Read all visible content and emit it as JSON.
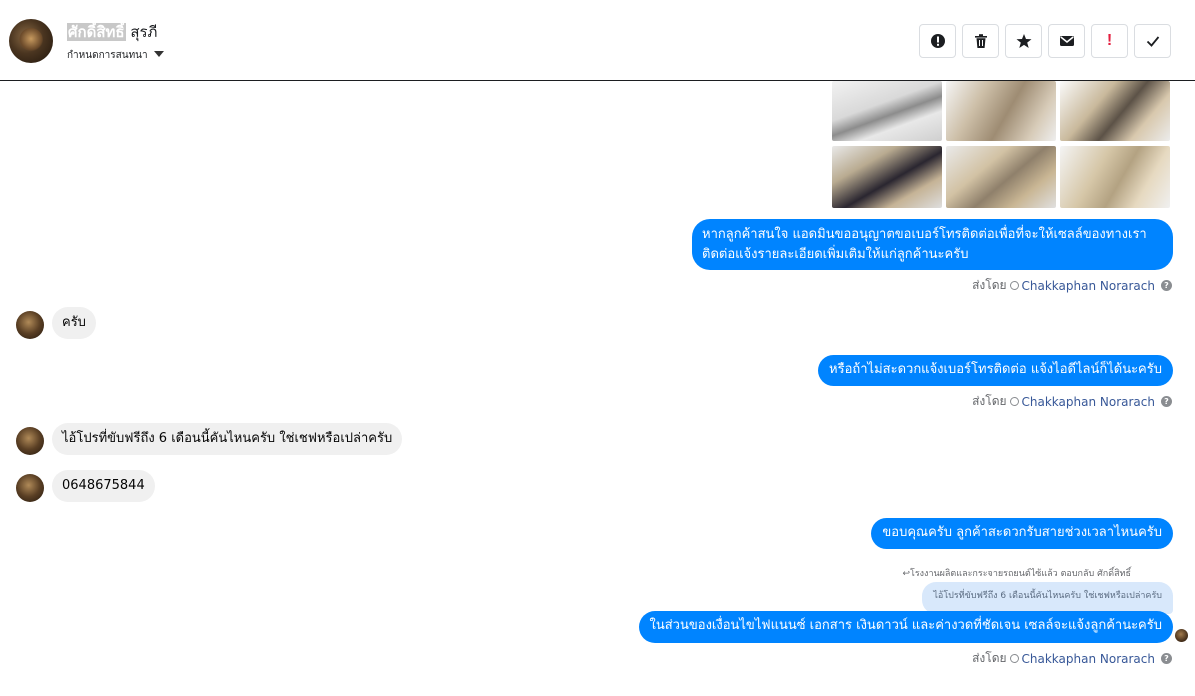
{
  "header": {
    "name_highlight": "ศักดิ์สิทธิ์",
    "name_rest": " สุรภี",
    "subtitle": "กำหนดการสนทนา"
  },
  "toolbar": {
    "buttons": [
      "alert-icon",
      "trash-icon",
      "star-icon",
      "mail-icon",
      "exclamation-icon",
      "check-icon"
    ],
    "excl_label": "!"
  },
  "messages": {
    "out1": "หากลูกค้าสนใจ แอดมินขออนุญาตขอเบอร์โทรติดต่อเพื่อที่จะให้เซลล์ของทางเรา",
    "out1b": "ติดต่อแจ้งรายละเอียดเพิ่มเติมให้แก่ลูกค้านะครับ",
    "in1": "ครับ",
    "out2": "หรือถ้าไม่สะดวกแจ้งเบอร์โทรติดต่อ แจ้งไอดีไลน์ก็ได้นะครับ",
    "in2": "ไอ้โปรที่ขับฟรีถึง 6 เดือนนี้คันไหนครับ ใช่เชฟหรือเปล่าครับ",
    "in3": "0648675844",
    "out3": "ขอบคุณครับ ลูกค้าสะดวกรับสายช่วงเวลาไหนครับ",
    "reply_note": "โรงงานผลิตและกระจายรถยนต์ไซ้แล้ว ตอบกลับ ศักดิ์สิทธิ์",
    "reply_quote": "ไอ้โปรที่ขับฟรีถึง 6 เดือนนี้คันไหนครับ ใช่เชฟหรือเปล่าครับ",
    "out4": "ในส่วนของเงื่อนไขไฟแนนซ์ เอกสาร เงินดาวน์ และค่างวดที่ชัดเจน เซลล์จะแจ้งลูกค้านะครับ"
  },
  "sent_by": {
    "prefix": "ส่งโดย",
    "agent": "Chakkaphan Norarach",
    "help": "?"
  },
  "colors": {
    "outgoing_bubble": "#0084ff",
    "incoming_bubble": "#f0f0f0",
    "agent_link": "#385898"
  }
}
